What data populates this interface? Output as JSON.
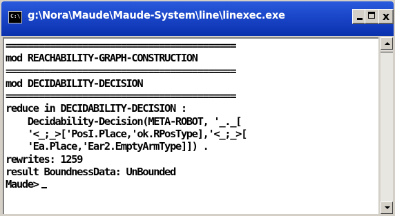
{
  "window": {
    "title": "g:\\Nora\\Maude\\Maude-System\\line\\linexec.exe",
    "icon_name": "console-app-icon",
    "icon_text": "C:\\",
    "buttons": {
      "minimize_icon": "minimize-icon",
      "maximize_icon": "maximize-icon",
      "close_label": "x",
      "close_icon": "close-icon"
    },
    "colors": {
      "titlebar": "#0a31ae",
      "console_bg": "#ffffff",
      "console_text": "#000000"
    }
  },
  "console": {
    "lines": [
      "==========================================",
      "mod REACHABILITY-GRAPH-CONSTRUCTION",
      "==========================================",
      "mod DECIDABILITY-DECISION",
      "==========================================",
      "reduce in DECIDABILITY-DECISION :",
      "    Decidability-Decision(META-ROBOT, '_._[",
      "    '<_;_>['PosI.Place,'ok.RPosType],'<_;_>[",
      "    'Ea.Place,'Ear2.EmptyArmType]]) .",
      "rewrites: 1259",
      "result BoundnessData: UnBounded"
    ],
    "prompt": "Maude>"
  },
  "scrollbar": {
    "up_icon": "scroll-up-arrow-icon",
    "down_icon": "scroll-down-arrow-icon"
  }
}
